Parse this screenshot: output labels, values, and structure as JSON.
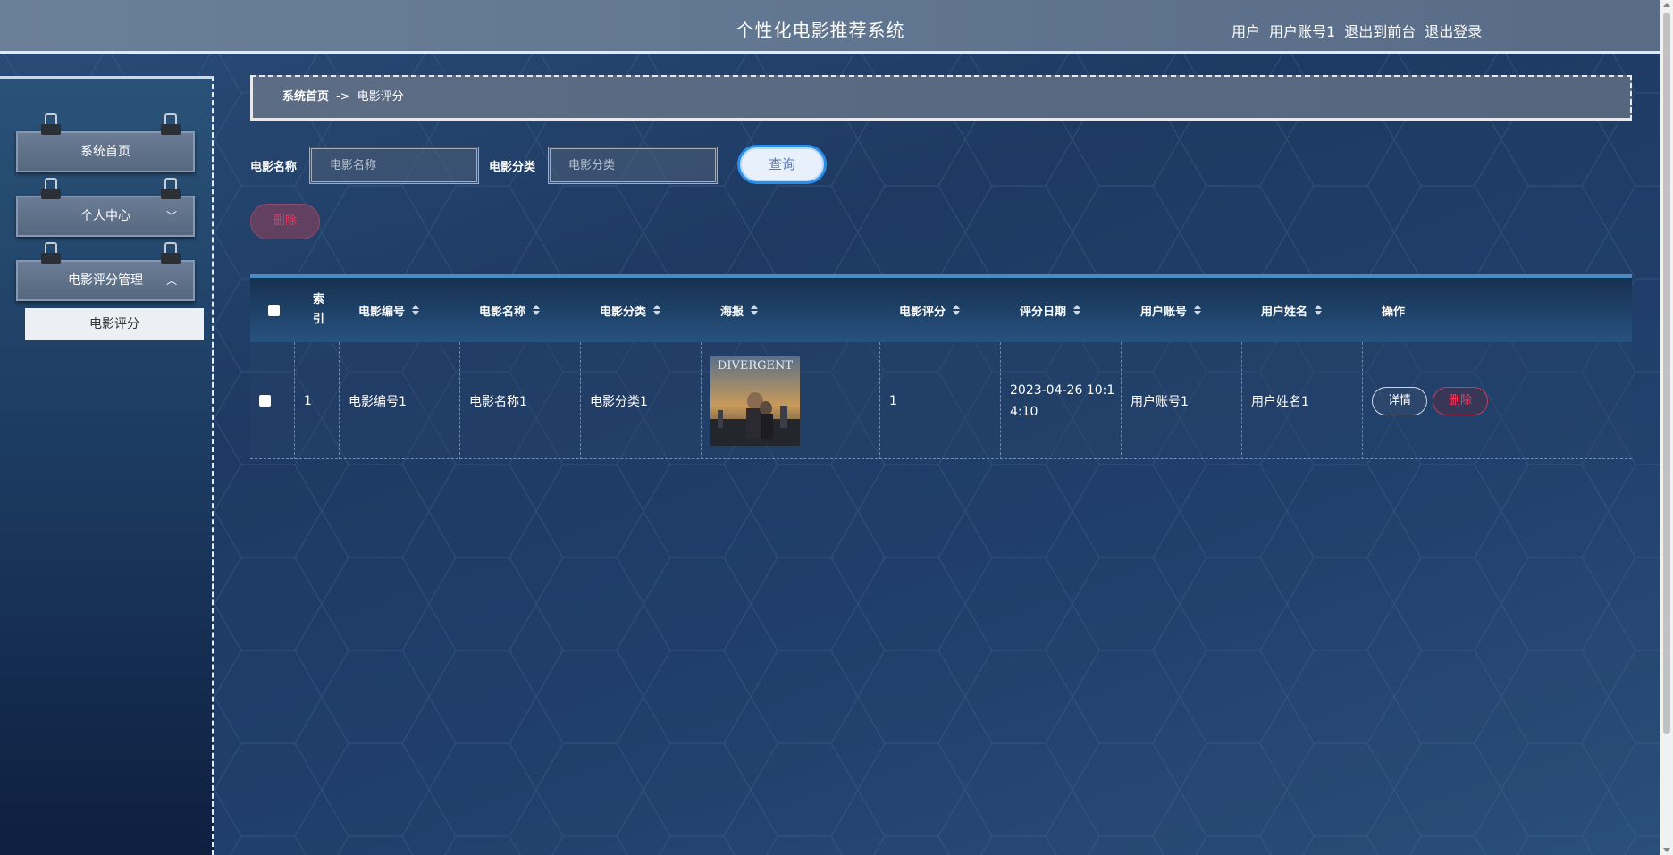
{
  "header": {
    "title": "个性化电影推荐系统",
    "user_role": "用户",
    "user_account": "用户账号1",
    "back_to_front": "退出到前台",
    "logout": "退出登录"
  },
  "sidebar": {
    "items": [
      {
        "label": "系统首页"
      },
      {
        "label": "个人中心",
        "chevron": "﹀"
      },
      {
        "label": "电影评分管理",
        "chevron": "︿"
      }
    ],
    "sub_item": "电影评分"
  },
  "breadcrumb": {
    "home": "系统首页",
    "separator": "->",
    "current": "电影评分"
  },
  "search": {
    "name_label": "电影名称",
    "name_placeholder": "电影名称",
    "category_label": "电影分类",
    "category_placeholder": "电影分类",
    "query_button": "查询"
  },
  "actions": {
    "batch_delete": "删除"
  },
  "table": {
    "columns": [
      "索引",
      "电影编号",
      "电影名称",
      "电影分类",
      "海报",
      "电影评分",
      "评分日期",
      "用户账号",
      "用户姓名",
      "操作"
    ],
    "rows": [
      {
        "index": "1",
        "movie_no": "电影编号1",
        "movie_name": "电影名称1",
        "category": "电影分类1",
        "poster_title": "DIVERGENT",
        "rating": "1",
        "date_line1": "2023-04-26 10:1",
        "date_line2": "4:10",
        "user_account": "用户账号1",
        "user_name": "用户姓名1",
        "detail_button": "详情",
        "delete_button": "删除"
      }
    ]
  },
  "colors": {
    "accent_blue": "#2a8fe8",
    "danger": "#ff3a5a"
  }
}
